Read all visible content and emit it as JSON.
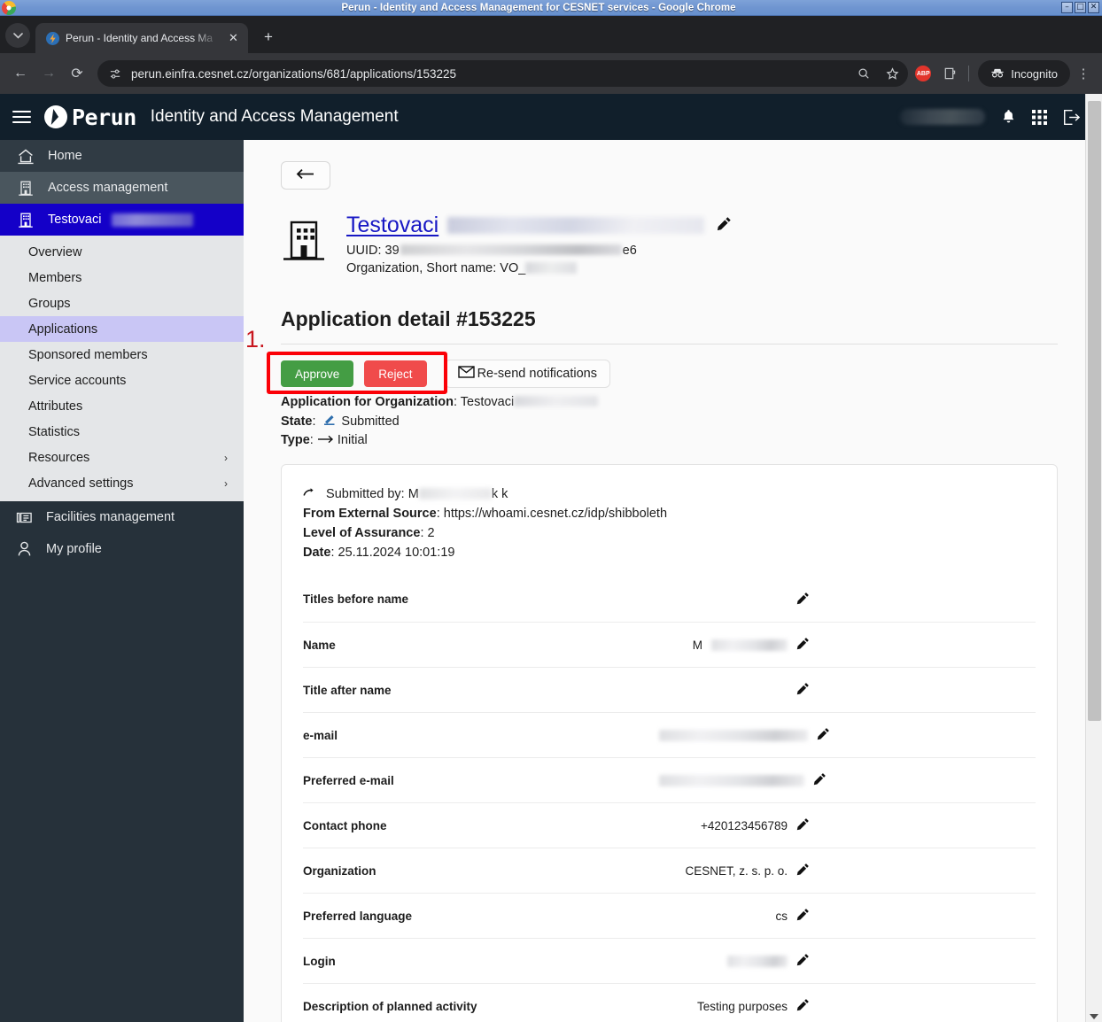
{
  "os_window": {
    "title": "Perun - Identity and Access Management for CESNET services - Google Chrome",
    "minimize": "–",
    "maximize": "□",
    "close": "✕"
  },
  "browser": {
    "tab_search_icon": "chevron-down-icon",
    "tab": {
      "favicon": "perun-bolt-favicon",
      "title": "Perun - Identity and Access Ma",
      "close_label": "✕"
    },
    "new_tab_label": "+",
    "back_label": "←",
    "forward_label": "→",
    "reload_label": "⟳",
    "url": "perun.einfra.cesnet.cz/organizations/681/applications/153225",
    "site_info_icon": "tune-icon",
    "zoom_icon": "search-icon",
    "bookmark_icon": "star-icon",
    "abp_label": "ABP",
    "extensions_icon": "extensions-icon",
    "incognito_label": "Incognito",
    "menu_icon": "kebab-menu-icon"
  },
  "app_header": {
    "menu_icon": "hamburger-icon",
    "brand": "Perun",
    "subtitle": "Identity and Access Management",
    "notifications_icon": "bell-icon",
    "apps_icon": "grid-apps-icon",
    "logout_icon": "logout-icon"
  },
  "sidebar": {
    "top_items": [
      {
        "label": "Home",
        "icon": "home-icon",
        "state": "normal"
      },
      {
        "label": "Access management",
        "icon": "building-icon",
        "state": "hover"
      },
      {
        "label": "Testovaci",
        "icon": "building-icon",
        "state": "selected",
        "redacted": true
      }
    ],
    "submenu": [
      {
        "label": "Overview",
        "active": false,
        "has_chevron": false
      },
      {
        "label": "Members",
        "active": false,
        "has_chevron": false
      },
      {
        "label": "Groups",
        "active": false,
        "has_chevron": false
      },
      {
        "label": "Applications",
        "active": true,
        "has_chevron": false
      },
      {
        "label": "Sponsored members",
        "active": false,
        "has_chevron": false
      },
      {
        "label": "Service accounts",
        "active": false,
        "has_chevron": false
      },
      {
        "label": "Attributes",
        "active": false,
        "has_chevron": false
      },
      {
        "label": "Statistics",
        "active": false,
        "has_chevron": false
      },
      {
        "label": "Resources",
        "active": false,
        "has_chevron": true
      },
      {
        "label": "Advanced settings",
        "active": false,
        "has_chevron": true
      }
    ],
    "chevron": "›",
    "bottom_items": [
      {
        "label": "Facilities management",
        "icon": "facility-icon"
      },
      {
        "label": "My profile",
        "icon": "person-icon"
      }
    ]
  },
  "main": {
    "back_button_icon": "arrow-left-icon",
    "organization": {
      "icon": "building-icon",
      "name": "Testovaci",
      "edit_icon": "pencil-icon",
      "uuid_label": "UUID: 39",
      "uuid_suffix": "e6",
      "type_line_prefix": "Organization, Short name: VO_"
    },
    "page_title": "Application detail #153225",
    "annotation": "1.",
    "actions": {
      "approve": "Approve",
      "reject": "Reject",
      "resend": "Re-send notifications",
      "resend_icon": "envelope-icon"
    },
    "meta": {
      "org_label": "Application for Organization",
      "org_value": "Testovaci",
      "state_label": "State",
      "state_value": "Submitted",
      "state_icon": "submitted-icon",
      "type_label": "Type",
      "type_value": "Initial",
      "type_icon": "arrow-right-icon"
    },
    "card": {
      "submitted_by_label": "Submitted by:",
      "submitted_by_icon": "redo-arrow-icon",
      "submitted_by_prefix": "M",
      "submitted_by_suffix": "k k",
      "external_source_label": "From External Source",
      "external_source_value": "https://whoami.cesnet.cz/idp/shibboleth",
      "loa_label": "Level of Assurance",
      "loa_value": "2",
      "date_label": "Date",
      "date_value": "25.11.2024 10:01:19"
    },
    "form_rows": [
      {
        "label": "Titles before name",
        "value": "",
        "redacted": false,
        "redact_width": 0
      },
      {
        "label": "Name",
        "value": "M",
        "redacted": true,
        "redact_width": 86
      },
      {
        "label": "Title after name",
        "value": "",
        "redacted": false,
        "redact_width": 0
      },
      {
        "label": "e-mail",
        "value": "",
        "redacted": true,
        "redact_width": 168
      },
      {
        "label": "Preferred e-mail",
        "value": "",
        "redacted": true,
        "redact_width": 164
      },
      {
        "label": "Contact phone",
        "value": "+420123456789",
        "redacted": false,
        "redact_width": 0
      },
      {
        "label": "Organization",
        "value": "CESNET, z. s. p. o.",
        "redacted": false,
        "redact_width": 0
      },
      {
        "label": "Preferred language",
        "value": "cs",
        "redacted": false,
        "redact_width": 0
      },
      {
        "label": "Login",
        "value": "",
        "redacted": true,
        "redact_width": 68
      },
      {
        "label": "Description of planned activity",
        "value": "Testing purposes",
        "redacted": false,
        "redact_width": 0
      }
    ],
    "pencil_icon": "pencil-icon"
  },
  "colors": {
    "brand_dark": "#111f2b",
    "sidebar": "#26313a",
    "selected_nav": "#1400c8",
    "active_submenu": "#c9c6f5",
    "approve_green": "#449d44",
    "reject_red": "#f04b4b",
    "annotation_red": "#fb0007",
    "link_blue": "#1717c4"
  }
}
